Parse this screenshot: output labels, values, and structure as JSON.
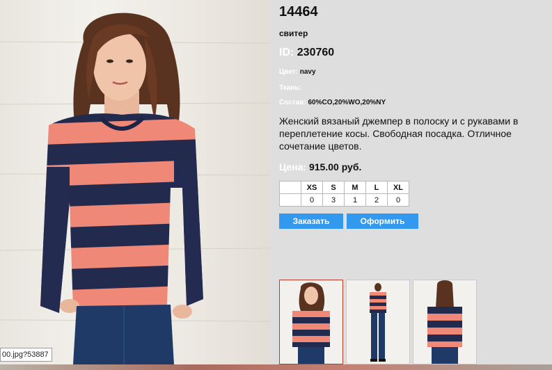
{
  "product": {
    "code": "14464",
    "type": "свитер",
    "id_label": "ID:",
    "id_value": "230760",
    "color_label": "Цвет:",
    "color_value": "navy",
    "fabric_label": "Ткань:",
    "fabric_value": "",
    "composition_label": "Состав:",
    "composition_value": "60%CO,20%WO,20%NY",
    "description": "Женский вязаный джемпер в полоску и с рукавами в переплетение косы. Свободная посадка. Отличное сочетание цветов.",
    "price_label": "Цена:",
    "price_value": "915.00 руб."
  },
  "size_table": {
    "sizes": [
      "XS",
      "S",
      "M",
      "L",
      "XL"
    ],
    "quantities": [
      "0",
      "3",
      "1",
      "2",
      "0"
    ]
  },
  "buttons": {
    "order": "Заказать",
    "checkout": "Оформить"
  },
  "url_tooltip": "00.jpg?53887",
  "thumbnails": [
    {
      "view": "front-closeup",
      "selected": true
    },
    {
      "view": "front-full",
      "selected": false
    },
    {
      "view": "back",
      "selected": false
    }
  ],
  "colors": {
    "panel_bg": "#dedede",
    "button_bg": "#3399ee",
    "label_white": "#ffffff",
    "sweater_navy": "#222a4e",
    "sweater_coral": "#f08878",
    "selected_thumb_border": "#c0392b"
  }
}
